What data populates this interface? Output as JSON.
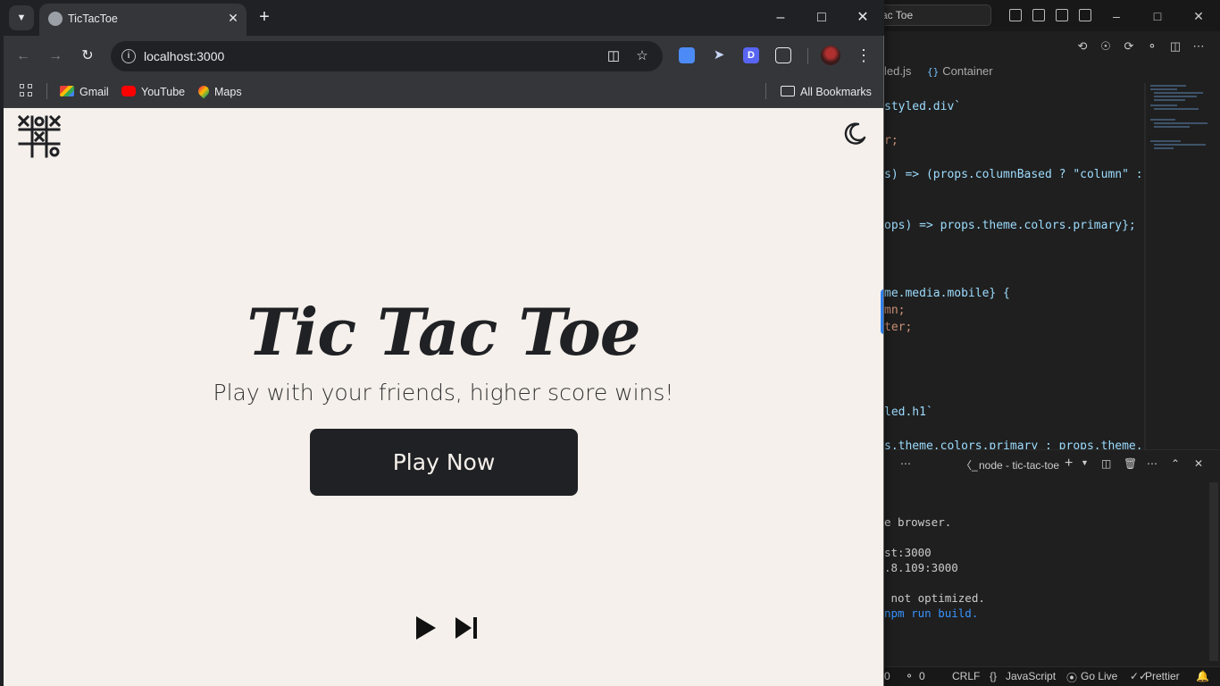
{
  "browser": {
    "tab_title": "TicTacToe",
    "url": "localhost:3000",
    "bookmarks": [
      {
        "label": "Gmail"
      },
      {
        "label": "YouTube"
      },
      {
        "label": "Maps"
      }
    ],
    "all_bookmarks_label": "All Bookmarks"
  },
  "page": {
    "title": "Tic Tac Toe",
    "subtitle": "Play with your friends, higher score wins!",
    "play_button": "Play Now"
  },
  "vscode": {
    "search_fragment": "ac Toe",
    "breadcrumb": {
      "file": "led.js",
      "symbol": "Container"
    },
    "code_lines": [
      {
        "text": "styled.div`",
        "color": "#9cdcfe"
      },
      {
        "text": "r;",
        "color": "#ce9178"
      },
      {
        "text": "s) => (props.columnBased ? \"column\" :",
        "color": "#9cdcfe"
      },
      {
        "text": "ops) => props.theme.colors.primary};",
        "color": "#9cdcfe"
      },
      {
        "text": "me.media.mobile} {",
        "color": "#9cdcfe"
      },
      {
        "text": "mn;",
        "color": "#ce9178"
      },
      {
        "text": "ter;",
        "color": "#ce9178"
      },
      {
        "text": "led.h1`",
        "color": "#9cdcfe"
      },
      {
        "text": "s.theme.colors.primary : props.theme.co",
        "color": "#9cdcfe"
      }
    ],
    "terminal_title": "node - tic-tac-toe",
    "terminal_lines": [
      {
        "text": "e browser.",
        "color": "#cccccc"
      },
      {
        "text": "st:3000",
        "color": "#cccccc"
      },
      {
        "text": ".8.109:3000",
        "color": "#cccccc"
      },
      {
        "text": " not optimized.",
        "color": "#cccccc"
      },
      {
        "text": "npm run build.",
        "color": "#3794ff"
      }
    ],
    "status": {
      "errors": "0",
      "ports": "0",
      "eol": "CRLF",
      "language": "JavaScript",
      "go_live": "Go Live",
      "prettier": "Prettier"
    }
  },
  "colors": {
    "page_background": "#f5f0eb",
    "primary": "#202124",
    "chrome_toolbar": "#35363a"
  }
}
